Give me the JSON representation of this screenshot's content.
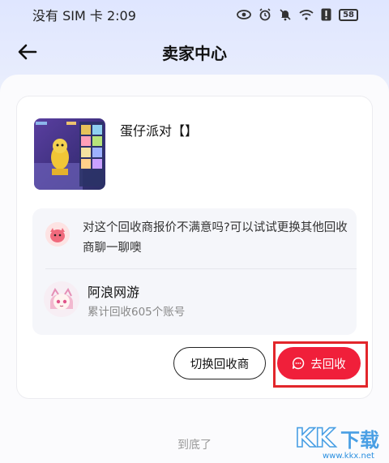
{
  "status_bar": {
    "left_text": "没有 SIM 卡 2:09",
    "battery": "58",
    "icons": [
      "eye-icon",
      "alarm-icon",
      "mute-icon",
      "wifi-icon",
      "alert-icon",
      "battery-icon"
    ]
  },
  "header": {
    "title": "卖家中心",
    "back_icon": "back-arrow-icon"
  },
  "product": {
    "title": "蛋仔派对【】",
    "thumbnail": "game-screenshot"
  },
  "recommendation": {
    "tip": "对这个回收商报价不满意吗?可以试试更换其他回收商聊一聊噢",
    "dealer_name": "阿浪网游",
    "dealer_stats": "累计回收605个账号"
  },
  "actions": {
    "switch_label": "切换回收商",
    "go_label": "去回收",
    "go_icon": "chat-bubble-icon"
  },
  "footer": {
    "end_text": "到底了"
  },
  "watermark": {
    "text": "KK下载",
    "url": "www.kkx.net"
  },
  "colors": {
    "accent_red": "#f01f3a",
    "highlight_red": "#e2262b",
    "background_top": "#dfe6ff"
  }
}
